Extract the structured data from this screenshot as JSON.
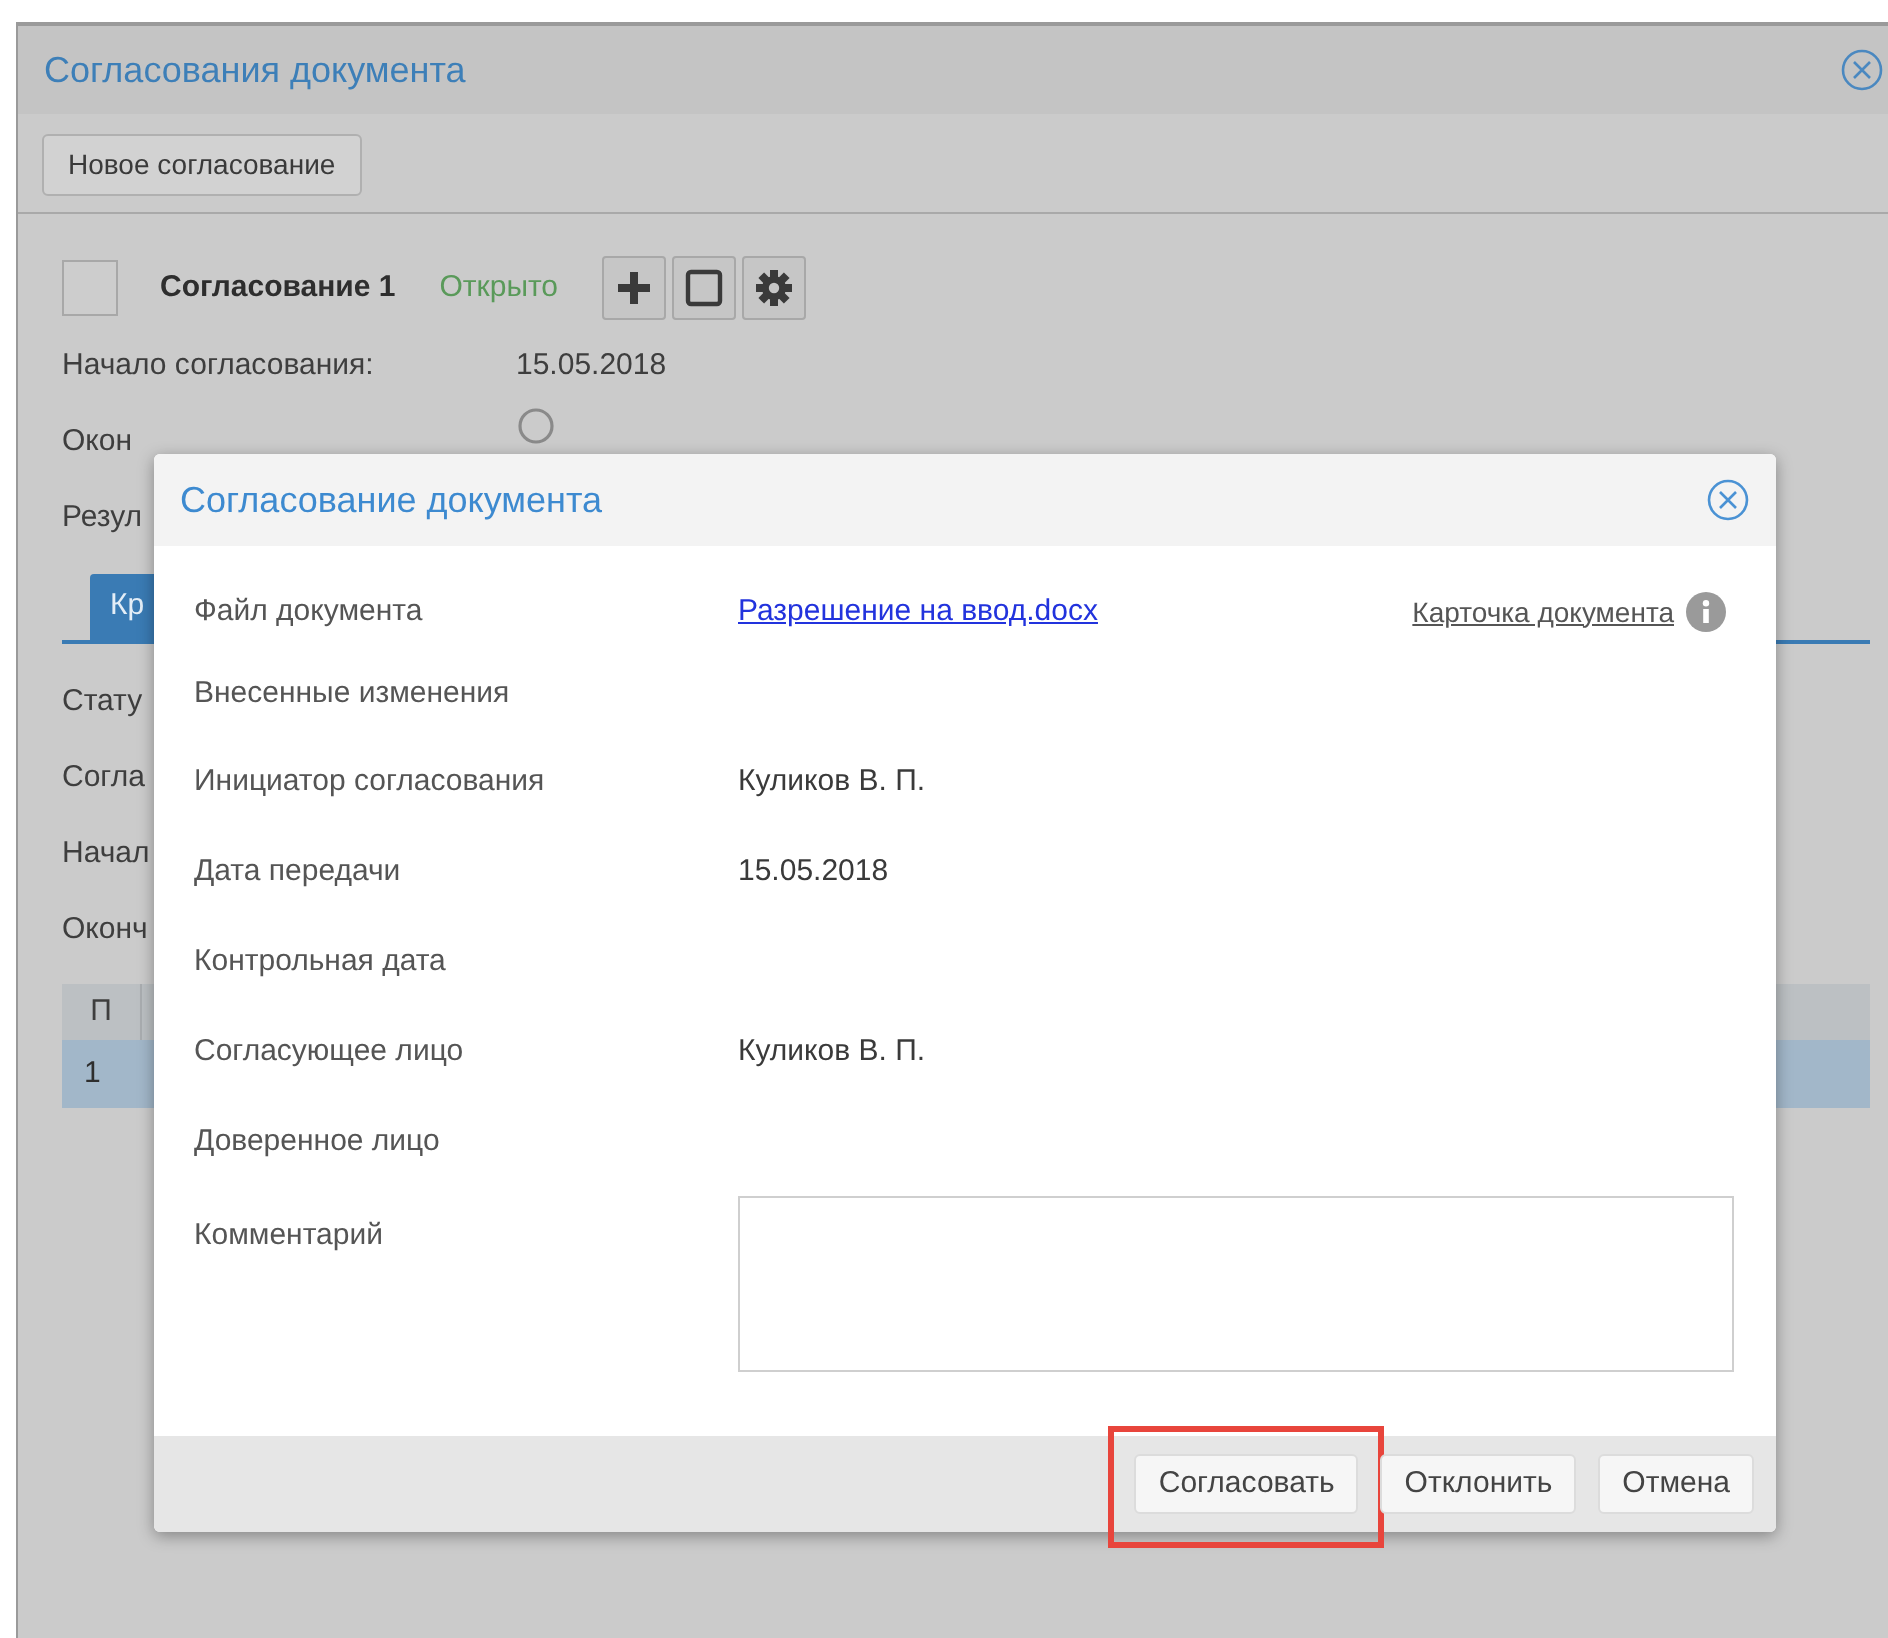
{
  "window": {
    "title": "Согласования документа"
  },
  "toolbar": {
    "new_button": "Новое согласование"
  },
  "approval": {
    "checked": false,
    "title": "Согласование 1",
    "status": "Открыто",
    "start_label": "Начало согласования:",
    "start_value": "15.05.2018",
    "end_label": "Окон",
    "result_label": "Резул"
  },
  "tabs": [
    {
      "label": "Кр",
      "selected": true
    }
  ],
  "details": [
    "Стату",
    "Согла",
    "Начал",
    "Оконч"
  ],
  "table": {
    "columns": [
      "П"
    ],
    "rows": [
      {
        "cells": [
          "1"
        ],
        "selected": true
      }
    ]
  },
  "dialog": {
    "title": "Согласование документа",
    "fields": [
      {
        "kind": "link",
        "label": "Файл документа",
        "value": "Разрешение на ввод.docx",
        "extra_link": "Карточка документа"
      },
      {
        "kind": "empty",
        "label": "Внесенные изменения"
      },
      {
        "kind": "text",
        "label": "Инициатор согласования",
        "value": "Куликов В. П."
      },
      {
        "kind": "text",
        "label": "Дата передачи",
        "value": "15.05.2018"
      },
      {
        "kind": "empty",
        "label": "Контрольная дата"
      },
      {
        "kind": "text",
        "label": "Согласующее лицо",
        "value": "Куликов В. П."
      },
      {
        "kind": "empty",
        "label": "Доверенное лицо"
      },
      {
        "kind": "textarea",
        "label": "Комментарий"
      }
    ],
    "buttons": [
      {
        "label": "Согласовать",
        "highlighted": true
      },
      {
        "label": "Отклонить",
        "highlighted": false
      },
      {
        "label": "Отмена",
        "highlighted": false
      }
    ]
  }
}
